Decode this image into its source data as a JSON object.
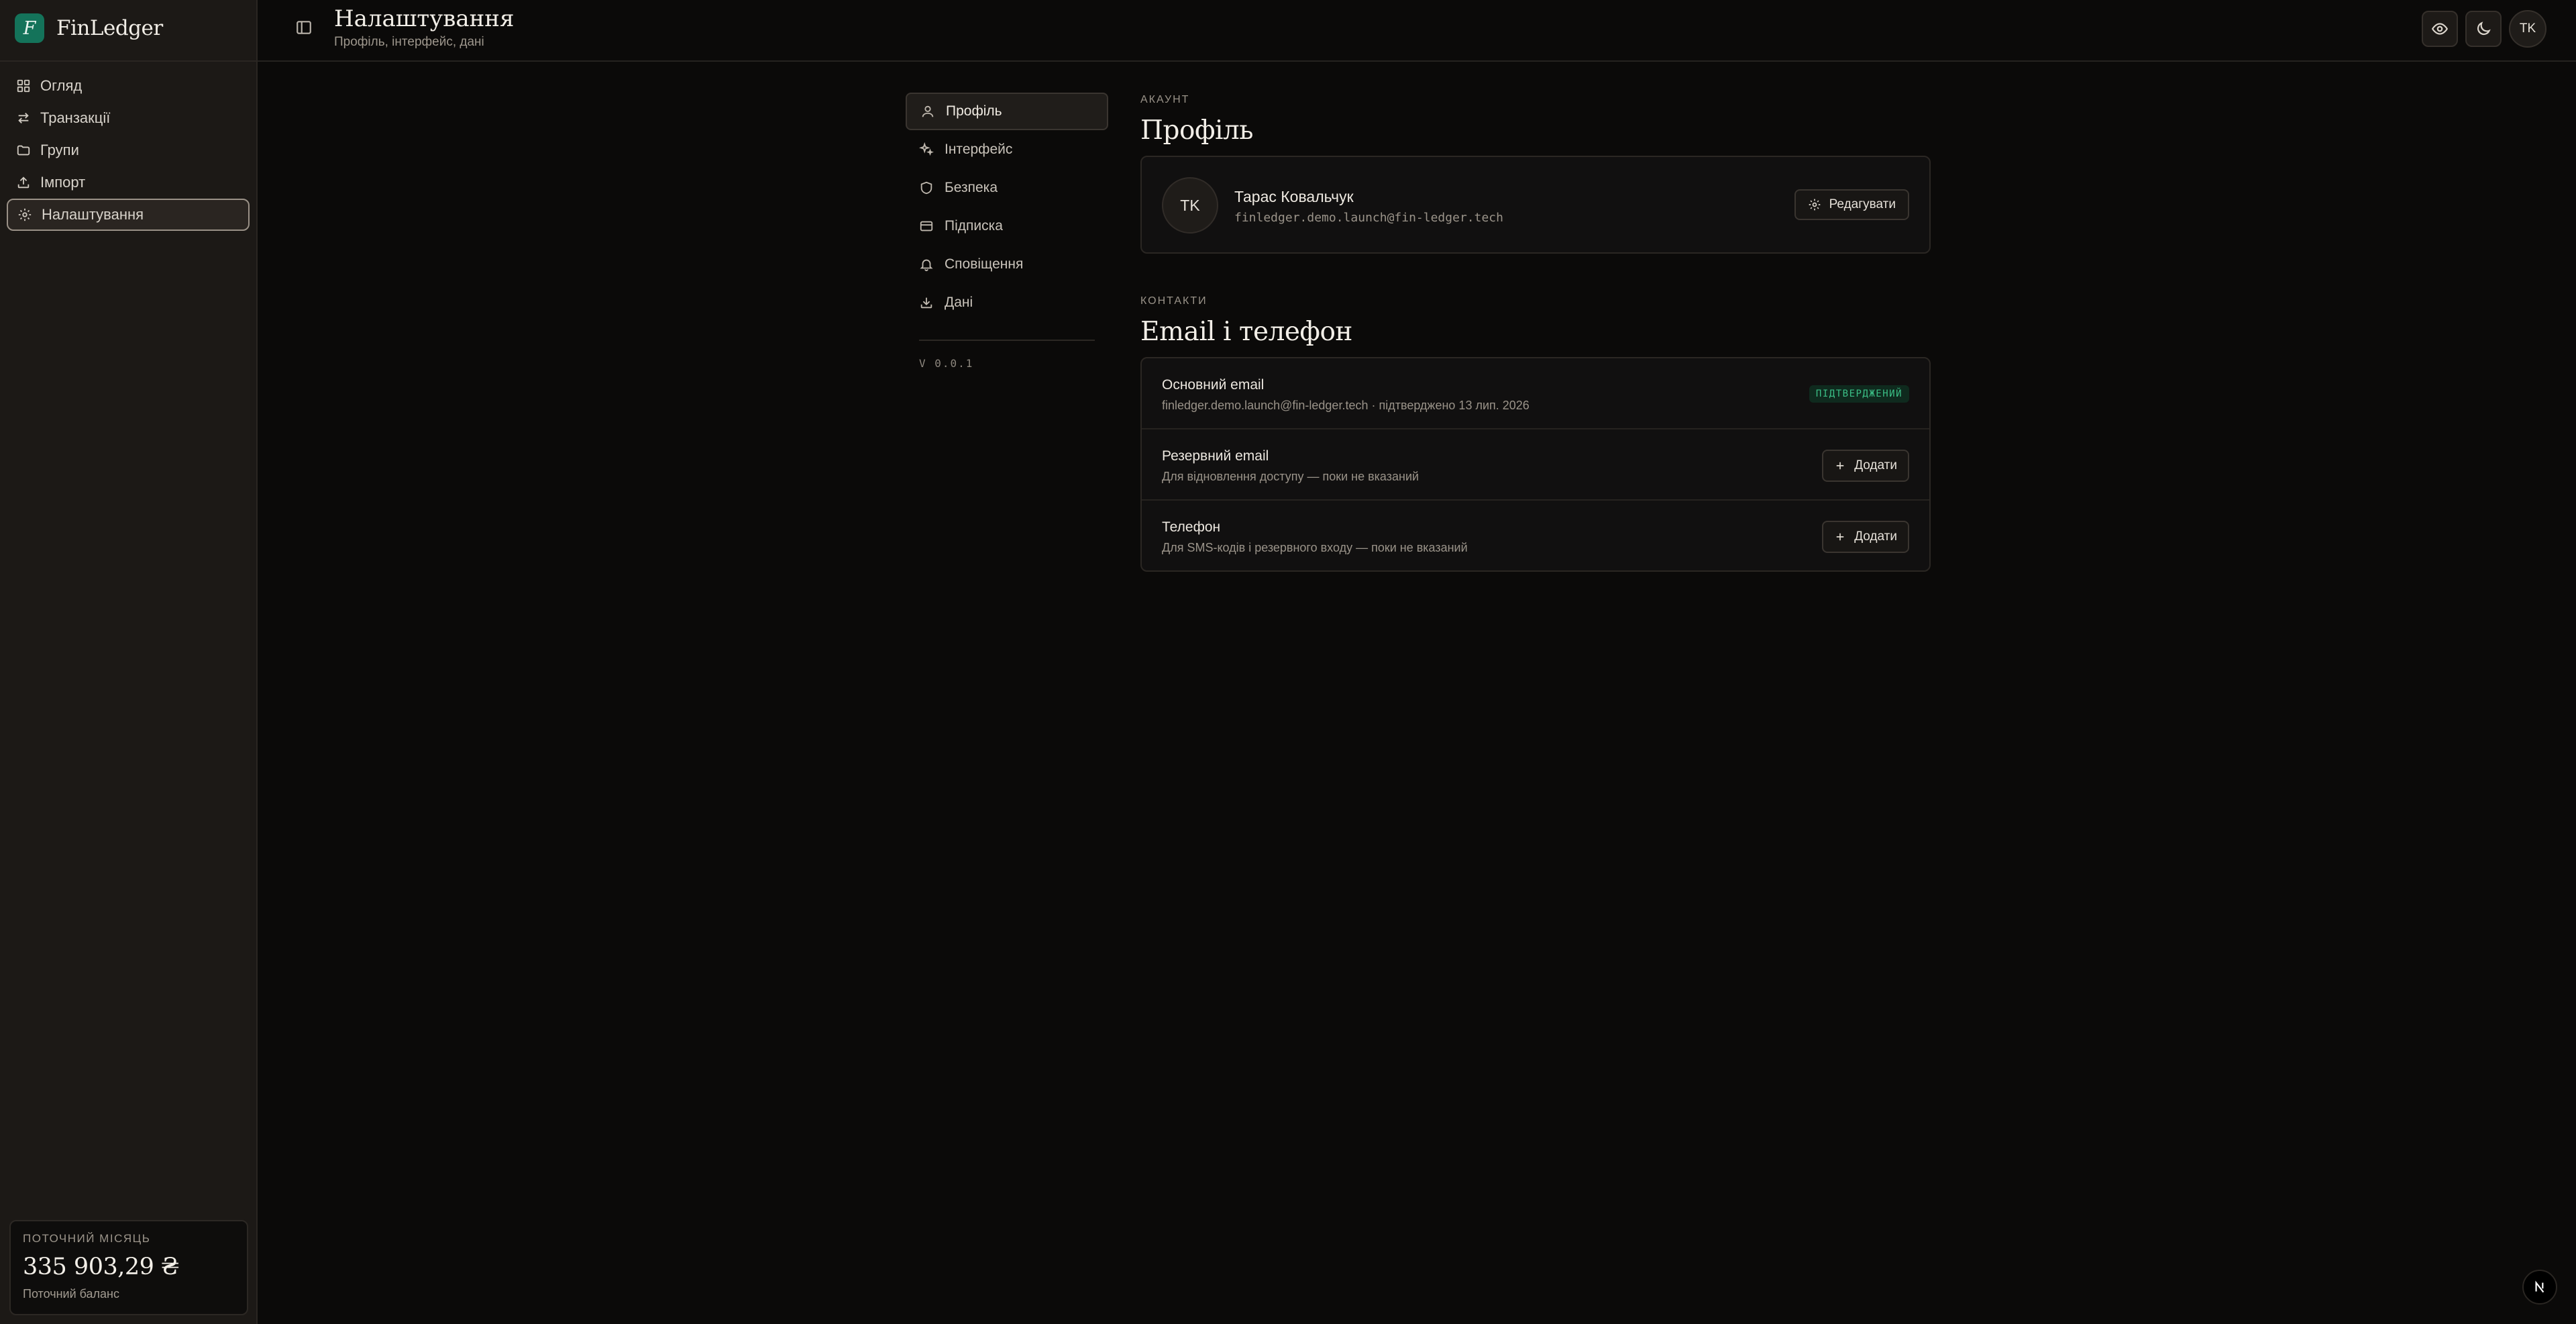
{
  "app": {
    "name": "FinLedger",
    "logo_letter": "F"
  },
  "sidebar": {
    "items": [
      {
        "label": "Огляд",
        "icon": "grid-icon"
      },
      {
        "label": "Транзакції",
        "icon": "arrows-exchange-icon"
      },
      {
        "label": "Групи",
        "icon": "folder-icon"
      },
      {
        "label": "Імпорт",
        "icon": "upload-icon"
      },
      {
        "label": "Налаштування",
        "icon": "gear-icon",
        "active": true
      }
    ],
    "balance": {
      "caption": "ПОТОЧНИЙ МІСЯЦЬ",
      "value": "335 903,29 ₴",
      "label": "Поточний баланс"
    }
  },
  "header": {
    "title": "Налаштування",
    "subtitle": "Профіль, інтерфейс, дані",
    "avatar_initials": "TK"
  },
  "settings_nav": {
    "items": [
      {
        "label": "Профіль",
        "icon": "user-icon",
        "active": true
      },
      {
        "label": "Інтерфейс",
        "icon": "sparkles-icon"
      },
      {
        "label": "Безпека",
        "icon": "shield-icon"
      },
      {
        "label": "Підписка",
        "icon": "credit-card-icon"
      },
      {
        "label": "Сповіщення",
        "icon": "bell-icon"
      },
      {
        "label": "Дані",
        "icon": "download-icon"
      }
    ],
    "version": "V 0.0.1"
  },
  "profile": {
    "section_label": "АКАУНТ",
    "title": "Профіль",
    "avatar_initials": "TK",
    "name": "Тарас Ковальчук",
    "email": "finledger.demo.launch@fin-ledger.tech",
    "edit_label": "Редагувати"
  },
  "contacts": {
    "section_label": "КОНТАКТИ",
    "title": "Email і телефон",
    "rows": [
      {
        "title": "Основний email",
        "desc": "finledger.demo.launch@fin-ledger.tech · підтверджено 13 лип. 2026",
        "badge": "ПІДТВЕРДЖЕНИЙ"
      },
      {
        "title": "Резервний email",
        "desc": "Для відновлення доступу — поки не вказаний",
        "action": "Додати"
      },
      {
        "title": "Телефон",
        "desc": "Для SMS-кодів і резервного входу — поки не вказаний",
        "action": "Додати"
      }
    ]
  },
  "colors": {
    "brand": "#14735a",
    "verified": "#3bbf86",
    "background": "#0b0a09",
    "sidebar": "#1c1916"
  }
}
